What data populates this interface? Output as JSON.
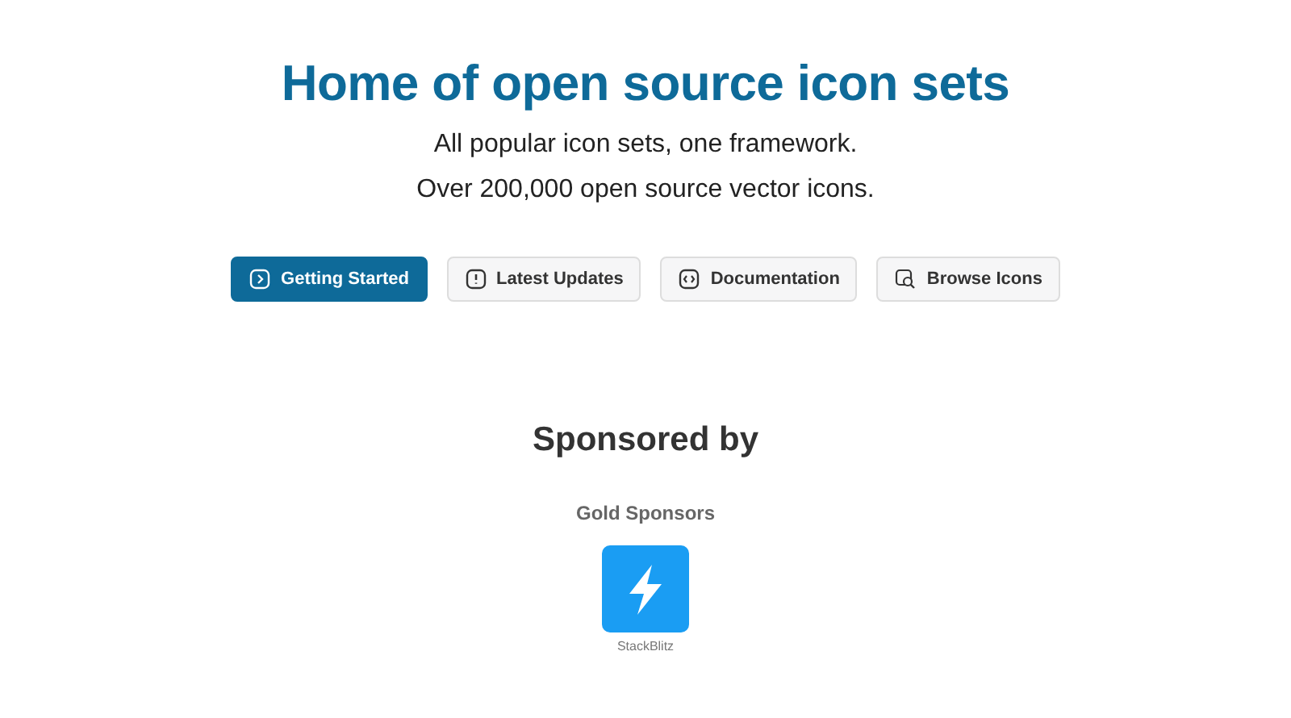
{
  "hero": {
    "title": "Home of open source icon sets",
    "taglines": [
      "All popular icon sets, one framework.",
      "Over 200,000 open source vector icons."
    ]
  },
  "buttons": [
    {
      "label": "Getting Started",
      "kind": "primary"
    },
    {
      "label": "Latest Updates",
      "kind": "secondary"
    },
    {
      "label": "Documentation",
      "kind": "secondary"
    },
    {
      "label": "Browse Icons",
      "kind": "secondary"
    }
  ],
  "sponsors": {
    "heading": "Sponsored by",
    "tiers": [
      {
        "name": "Gold Sponsors",
        "items": [
          {
            "name": "StackBlitz"
          }
        ]
      }
    ]
  }
}
